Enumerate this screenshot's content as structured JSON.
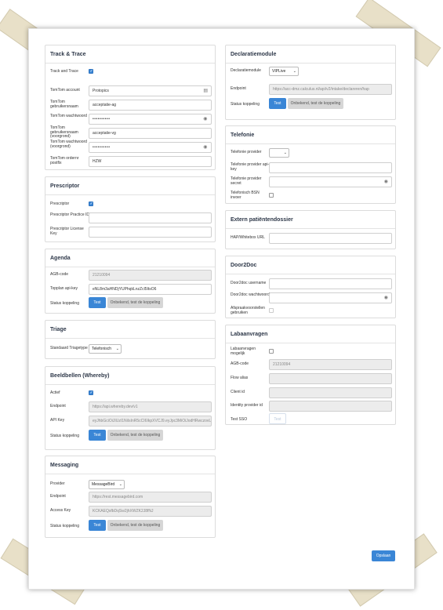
{
  "track_trace": {
    "title": "Track & Trace",
    "track_label": "Track and Trace",
    "account_label": "TomTom account",
    "account_value": "Protopics",
    "user_label": "TomTom gebruikersnaam",
    "user_value": "acceptatie-ag",
    "pass_label": "TomTom wachtwoord",
    "pass_value": "••••••••••",
    "user_vg_label": "TomTom gebruikersnaam (voorgrond)",
    "user_vg_value": "acceptatie-vg",
    "pass_vg_label": "TomTom wachtwoord (voorgrond)",
    "pass_vg_value": "••••••••••",
    "ordernr_label": "TomTom ordernr postfix",
    "ordernr_value": "HZW"
  },
  "prescriptor": {
    "title": "Prescriptor",
    "enabled_label": "Prescriptor",
    "practice_label": "Prescriptor Practice ID",
    "license_label": "Prescriptor License Key"
  },
  "agenda": {
    "title": "Agenda",
    "agb_label": "AGB-code",
    "agb_value": "21210094",
    "api_label": "Topplan api-key",
    "api_value": "eNL8m3aHNDjYUPhqkLnzZcl5ItsO6",
    "status_label": "Status koppeling",
    "test_label": "Test",
    "status_text": "Onbekend, test de koppeling"
  },
  "triage": {
    "title": "Triage",
    "type_label": "Standaard Triagetype",
    "type_value": "Telefonisch"
  },
  "beeldbellen": {
    "title": "Beeldbellen (Whereby)",
    "active_label": "Actief",
    "endpoint_label": "Endpoint",
    "endpoint_value": "https://api.whereby.dev/v1",
    "apikey_label": "API Key",
    "apikey_value": "eyJhbGciOiJIUzI1NiIsInR5cCI6IkpXVCJ9.eyJpc3MiOiJodHRwczovL",
    "status_label": "Status koppeling",
    "test_label": "Test",
    "status_text": "Onbekend, test de koppeling"
  },
  "messaging": {
    "title": "Messaging",
    "provider_label": "Provider",
    "provider_value": "MessageBird",
    "endpoint_label": "Endpoint",
    "endpoint_value": "https://rest.messagebird.com",
    "access_label": "Access Key",
    "access_value": "KCKAEQsfbDqSw2jhXWZK2J8fNJ",
    "status_label": "Status koppeling",
    "test_label": "Test",
    "status_text": "Onbekend, test de koppeling"
  },
  "declaratie": {
    "title": "Declaratiemodule",
    "module_label": "Declaratiemodule",
    "module_value": "VIPLive",
    "endpoint_label": "Endpoint",
    "endpoint_value": "https://acc-dmz.calculus.nl/api/v2/intake/declareren/hap",
    "status_label": "Status koppeling",
    "test_label": "Test",
    "status_text": "Onbekend, test de koppeling"
  },
  "telefonie": {
    "title": "Telefonie",
    "provider_label": "Telefonie provider",
    "apikey_label": "Telefonie provider api-key",
    "secret_label": "Telefonie provider secret",
    "bsn_label": "Telefonisch BSN invoer"
  },
  "extern": {
    "title": "Extern patiëntendossier",
    "url_label": "HAP/Whitebox URL"
  },
  "door2doc": {
    "title": "Door2Doc",
    "user_label": "Door2doc username",
    "pass_label": "Door2doc wachtwoord",
    "afspraak_label": "Afspraakvoorstellen gebruiken"
  },
  "labaanvragen": {
    "title": "Labaanvragen",
    "mogelijk_label": "Labaanvragen mogelijk",
    "agb_label": "AGB-code",
    "agb_value": "21210094",
    "flow_label": "Flow alias",
    "client_label": "Client id",
    "identity_label": "Identity provider id",
    "sso_label": "Test SSO",
    "sso_button": "Test"
  },
  "footer": {
    "save_label": "Opslaan"
  },
  "colors": {
    "accent": "#3a86d6",
    "tape": "#e1d7b9"
  }
}
